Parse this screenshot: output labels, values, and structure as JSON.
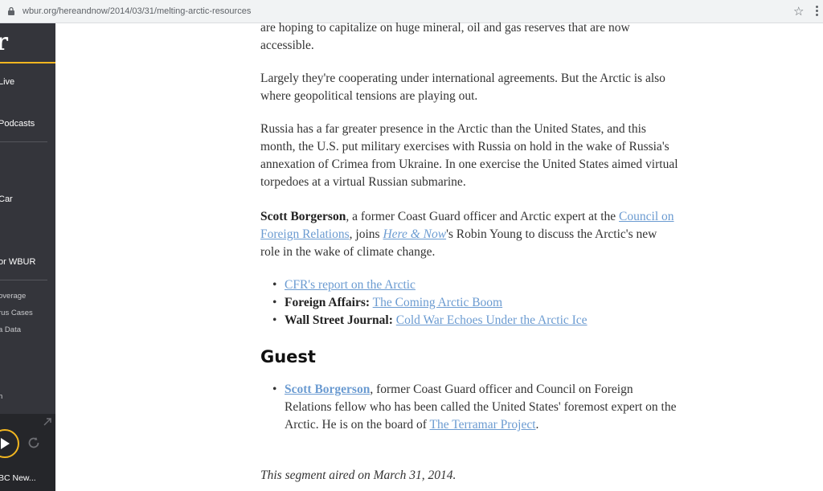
{
  "browser": {
    "url": "wbur.org/hereandnow/2014/03/31/melting-arctic-resources",
    "star_icon": "star-outline-icon",
    "lock_icon": "lock-icon",
    "menu_icon": "vertical-dots-icon"
  },
  "sidebar": {
    "logo": "r",
    "accent_color": "#f2b620",
    "items": [
      {
        "label": "Live"
      },
      {
        "label": "Podcasts"
      },
      {
        "label": "Car"
      },
      {
        "label": "or WBUR"
      }
    ],
    "sub_items": [
      {
        "label": "overage"
      },
      {
        "label": "rus Cases"
      },
      {
        "label": "a Data"
      },
      {
        "label": "h"
      }
    ],
    "player": {
      "now_playing": "BC New...",
      "play_icon": "play-icon",
      "replay_icon": "replay-icon",
      "expand_icon": "expand-arrow-icon"
    }
  },
  "article": {
    "p1": "are hoping to capitalize on huge mineral, oil and gas reserves that are now accessible.",
    "p2": "Largely they're cooperating under international agreements. But the Arctic is also where geopolitical tensions are playing out.",
    "p3": "Russia has a far greater presence in the Arctic than the United States, and this month, the U.S. put military exercises with Russia on hold in the wake of Russia's annexation of Crimea from Ukraine. In one exercise the United States aimed virtual torpedoes at a virtual Russian submarine.",
    "p4": {
      "name": "Scott Borgerson",
      "text1": ", a former Coast Guard officer and Arctic expert at the ",
      "link1": "Council on Foreign Relations",
      "text2": ", joins ",
      "link2": "Here & Now",
      "text3": "'s Robin Young to discuss the Arctic's new role in the wake of climate change."
    },
    "links": [
      {
        "source": "",
        "link": "CFR's report on the Arctic"
      },
      {
        "source": "Foreign Affairs:",
        "link": "The Coming Arctic Boom"
      },
      {
        "source": "Wall Street Journal:",
        "link": "Cold War Echoes Under the Arctic Ice"
      }
    ],
    "guest_heading": "Guest",
    "guest": {
      "name": "Scott Borgerson",
      "text1": ", former Coast Guard officer and Council on Foreign Relations fellow who has been called the United States' foremost expert on the Arctic. He is on the board of ",
      "link": "The Terramar Project",
      "text2": "."
    },
    "aired": "This segment aired on March 31, 2014."
  }
}
